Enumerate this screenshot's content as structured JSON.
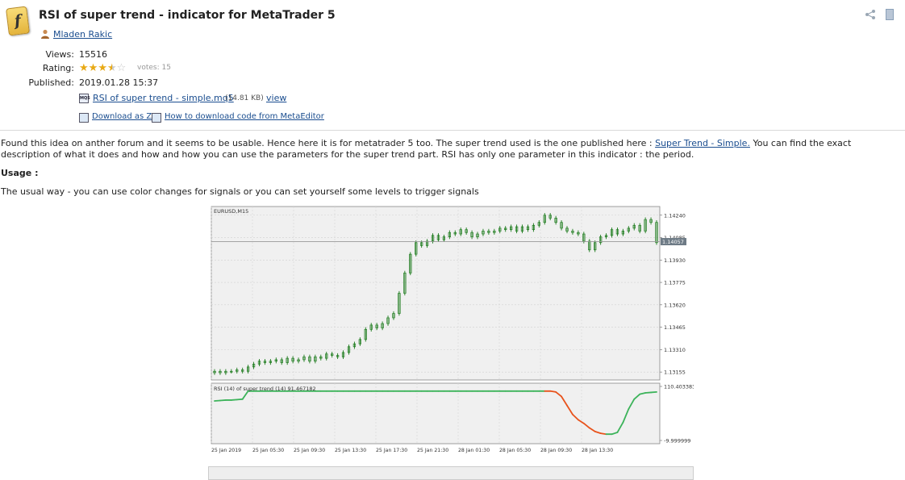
{
  "header": {
    "title": "RSI of super trend - indicator for MetaTrader 5",
    "author": "Mladen Rakic"
  },
  "meta": {
    "views_label": "Views:",
    "views_value": "15516",
    "rating_label": "Rating:",
    "rating_stars": 3.5,
    "votes": "votes: 15",
    "published_label": "Published:",
    "published_value": "2019.01.28 15:37"
  },
  "files": {
    "file_name": "RSI of super trend - simple.mq5",
    "file_size": "(14.81 KB)",
    "view_link": "view",
    "download_zip": "Download as ZIP",
    "how_to_download": "How to download code from MetaEditor"
  },
  "description": {
    "para1_start": "Found this idea on anther forum and it seems to be usable. Hence here it is for metatrader 5 too. The super trend used is the one published here :",
    "para1_link": "Super Trend - Simple.",
    "para1_end": "You can find the exact description of what it does and how and how you can use the parameters for the super trend part. RSI has only one parameter in this indicator : the period.",
    "usage_heading": "Usage :",
    "usage_text": "The usual way - you can use color changes for signals or you can set yourself some levels to trigger signals"
  },
  "colors": {
    "chart_bg": "#f0f0f0",
    "candle": "#1a7a1a",
    "rsi_up": "#3cb35a",
    "rsi_down": "#e8531c"
  },
  "chart_data": [
    {
      "type": "line",
      "title": "EURUSD,M15",
      "y_ticks": [
        "1.14240",
        "1.14085",
        "1.13930",
        "1.13775",
        "1.13620",
        "1.13465",
        "1.13310",
        "1.13155"
      ],
      "ylim": [
        1.131,
        1.143
      ],
      "current_price_label": "1.14057",
      "current_price": 1.14057,
      "close_values": [
        1.1316,
        1.1315,
        1.1316,
        1.1316,
        1.1317,
        1.1316,
        1.1319,
        1.1321,
        1.1323,
        1.1322,
        1.1323,
        1.1324,
        1.1322,
        1.1325,
        1.1323,
        1.1324,
        1.1326,
        1.1323,
        1.1326,
        1.1325,
        1.1328,
        1.1327,
        1.1326,
        1.1329,
        1.1333,
        1.1335,
        1.1338,
        1.1345,
        1.1348,
        1.1346,
        1.1349,
        1.1353,
        1.1356,
        1.137,
        1.1384,
        1.1397,
        1.1405,
        1.1403,
        1.1406,
        1.141,
        1.1407,
        1.1409,
        1.1412,
        1.1411,
        1.1414,
        1.1412,
        1.1409,
        1.1411,
        1.1413,
        1.1412,
        1.1413,
        1.1415,
        1.1414,
        1.1416,
        1.1413,
        1.1416,
        1.1414,
        1.1417,
        1.1419,
        1.1424,
        1.1422,
        1.1419,
        1.1415,
        1.1413,
        1.1412,
        1.1411,
        1.1406,
        1.14,
        1.1405,
        1.1409,
        1.141,
        1.1414,
        1.1411,
        1.1413,
        1.1415,
        1.1417,
        1.1413,
        1.1421,
        1.1419,
        1.1405
      ],
      "x_ticks": [
        "25 Jan 2019",
        "25 Jan 05:30",
        "25 Jan 09:30",
        "25 Jan 13:30",
        "25 Jan 17:30",
        "25 Jan 21:30",
        "28 Jan 01:30",
        "28 Jan 05:30",
        "28 Jan 09:30",
        "28 Jan 13:30"
      ],
      "grid": true
    },
    {
      "type": "line",
      "title": "RSI (14) of super trend (14) 91.467182",
      "y_ticks": [
        "110.403383",
        "-9.999999"
      ],
      "ylim": [
        -10,
        110.403383
      ],
      "series": [
        {
          "values": [
            78,
            79,
            80,
            80,
            81,
            82,
            100,
            100,
            100,
            100,
            100,
            100,
            100,
            100,
            100,
            100,
            100,
            100,
            100,
            100,
            100,
            100,
            100,
            100,
            100,
            100,
            100,
            100,
            100,
            100,
            100,
            100,
            100,
            100,
            100,
            100,
            100,
            100,
            100,
            100,
            100,
            100,
            100,
            100,
            100,
            100,
            100,
            100,
            100,
            100,
            100,
            100,
            100,
            100,
            100,
            100,
            100,
            100,
            100,
            100,
            100,
            98,
            88,
            68,
            48,
            36,
            28,
            18,
            10,
            6,
            4,
            4,
            8,
            30,
            60,
            82,
            93,
            96,
            97,
            98
          ],
          "color_segments": [
            "up",
            "up",
            "up",
            "up",
            "up",
            "up",
            "up",
            "up",
            "up",
            "up",
            "up",
            "up",
            "up",
            "up",
            "up",
            "up",
            "up",
            "up",
            "up",
            "up",
            "up",
            "up",
            "up",
            "up",
            "up",
            "up",
            "up",
            "up",
            "up",
            "up",
            "up",
            "up",
            "up",
            "up",
            "up",
            "up",
            "up",
            "up",
            "up",
            "up",
            "up",
            "up",
            "up",
            "up",
            "up",
            "up",
            "up",
            "up",
            "up",
            "up",
            "up",
            "up",
            "up",
            "up",
            "up",
            "up",
            "up",
            "up",
            "up",
            "up",
            "down",
            "down",
            "down",
            "down",
            "down",
            "down",
            "down",
            "down",
            "down",
            "down",
            "down",
            "up",
            "up",
            "up",
            "up",
            "up",
            "up",
            "up",
            "up",
            "up"
          ]
        }
      ],
      "grid": true
    }
  ]
}
